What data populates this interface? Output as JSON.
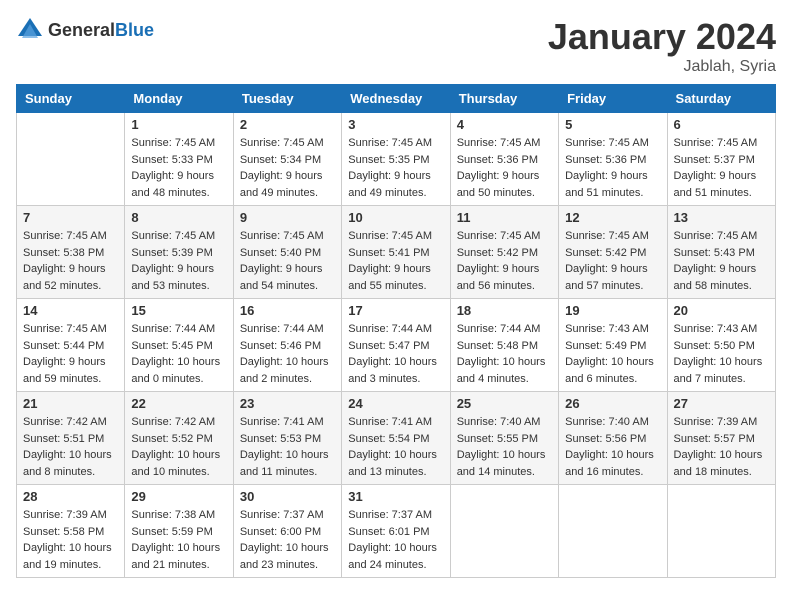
{
  "logo": {
    "general": "General",
    "blue": "Blue"
  },
  "title": "January 2024",
  "location": "Jablah, Syria",
  "days_of_week": [
    "Sunday",
    "Monday",
    "Tuesday",
    "Wednesday",
    "Thursday",
    "Friday",
    "Saturday"
  ],
  "weeks": [
    [
      {
        "day": "",
        "sunrise": "",
        "sunset": "",
        "daylight": ""
      },
      {
        "day": "1",
        "sunrise": "Sunrise: 7:45 AM",
        "sunset": "Sunset: 5:33 PM",
        "daylight": "Daylight: 9 hours and 48 minutes."
      },
      {
        "day": "2",
        "sunrise": "Sunrise: 7:45 AM",
        "sunset": "Sunset: 5:34 PM",
        "daylight": "Daylight: 9 hours and 49 minutes."
      },
      {
        "day": "3",
        "sunrise": "Sunrise: 7:45 AM",
        "sunset": "Sunset: 5:35 PM",
        "daylight": "Daylight: 9 hours and 49 minutes."
      },
      {
        "day": "4",
        "sunrise": "Sunrise: 7:45 AM",
        "sunset": "Sunset: 5:36 PM",
        "daylight": "Daylight: 9 hours and 50 minutes."
      },
      {
        "day": "5",
        "sunrise": "Sunrise: 7:45 AM",
        "sunset": "Sunset: 5:36 PM",
        "daylight": "Daylight: 9 hours and 51 minutes."
      },
      {
        "day": "6",
        "sunrise": "Sunrise: 7:45 AM",
        "sunset": "Sunset: 5:37 PM",
        "daylight": "Daylight: 9 hours and 51 minutes."
      }
    ],
    [
      {
        "day": "7",
        "sunrise": "Sunrise: 7:45 AM",
        "sunset": "Sunset: 5:38 PM",
        "daylight": "Daylight: 9 hours and 52 minutes."
      },
      {
        "day": "8",
        "sunrise": "Sunrise: 7:45 AM",
        "sunset": "Sunset: 5:39 PM",
        "daylight": "Daylight: 9 hours and 53 minutes."
      },
      {
        "day": "9",
        "sunrise": "Sunrise: 7:45 AM",
        "sunset": "Sunset: 5:40 PM",
        "daylight": "Daylight: 9 hours and 54 minutes."
      },
      {
        "day": "10",
        "sunrise": "Sunrise: 7:45 AM",
        "sunset": "Sunset: 5:41 PM",
        "daylight": "Daylight: 9 hours and 55 minutes."
      },
      {
        "day": "11",
        "sunrise": "Sunrise: 7:45 AM",
        "sunset": "Sunset: 5:42 PM",
        "daylight": "Daylight: 9 hours and 56 minutes."
      },
      {
        "day": "12",
        "sunrise": "Sunrise: 7:45 AM",
        "sunset": "Sunset: 5:42 PM",
        "daylight": "Daylight: 9 hours and 57 minutes."
      },
      {
        "day": "13",
        "sunrise": "Sunrise: 7:45 AM",
        "sunset": "Sunset: 5:43 PM",
        "daylight": "Daylight: 9 hours and 58 minutes."
      }
    ],
    [
      {
        "day": "14",
        "sunrise": "Sunrise: 7:45 AM",
        "sunset": "Sunset: 5:44 PM",
        "daylight": "Daylight: 9 hours and 59 minutes."
      },
      {
        "day": "15",
        "sunrise": "Sunrise: 7:44 AM",
        "sunset": "Sunset: 5:45 PM",
        "daylight": "Daylight: 10 hours and 0 minutes."
      },
      {
        "day": "16",
        "sunrise": "Sunrise: 7:44 AM",
        "sunset": "Sunset: 5:46 PM",
        "daylight": "Daylight: 10 hours and 2 minutes."
      },
      {
        "day": "17",
        "sunrise": "Sunrise: 7:44 AM",
        "sunset": "Sunset: 5:47 PM",
        "daylight": "Daylight: 10 hours and 3 minutes."
      },
      {
        "day": "18",
        "sunrise": "Sunrise: 7:44 AM",
        "sunset": "Sunset: 5:48 PM",
        "daylight": "Daylight: 10 hours and 4 minutes."
      },
      {
        "day": "19",
        "sunrise": "Sunrise: 7:43 AM",
        "sunset": "Sunset: 5:49 PM",
        "daylight": "Daylight: 10 hours and 6 minutes."
      },
      {
        "day": "20",
        "sunrise": "Sunrise: 7:43 AM",
        "sunset": "Sunset: 5:50 PM",
        "daylight": "Daylight: 10 hours and 7 minutes."
      }
    ],
    [
      {
        "day": "21",
        "sunrise": "Sunrise: 7:42 AM",
        "sunset": "Sunset: 5:51 PM",
        "daylight": "Daylight: 10 hours and 8 minutes."
      },
      {
        "day": "22",
        "sunrise": "Sunrise: 7:42 AM",
        "sunset": "Sunset: 5:52 PM",
        "daylight": "Daylight: 10 hours and 10 minutes."
      },
      {
        "day": "23",
        "sunrise": "Sunrise: 7:41 AM",
        "sunset": "Sunset: 5:53 PM",
        "daylight": "Daylight: 10 hours and 11 minutes."
      },
      {
        "day": "24",
        "sunrise": "Sunrise: 7:41 AM",
        "sunset": "Sunset: 5:54 PM",
        "daylight": "Daylight: 10 hours and 13 minutes."
      },
      {
        "day": "25",
        "sunrise": "Sunrise: 7:40 AM",
        "sunset": "Sunset: 5:55 PM",
        "daylight": "Daylight: 10 hours and 14 minutes."
      },
      {
        "day": "26",
        "sunrise": "Sunrise: 7:40 AM",
        "sunset": "Sunset: 5:56 PM",
        "daylight": "Daylight: 10 hours and 16 minutes."
      },
      {
        "day": "27",
        "sunrise": "Sunrise: 7:39 AM",
        "sunset": "Sunset: 5:57 PM",
        "daylight": "Daylight: 10 hours and 18 minutes."
      }
    ],
    [
      {
        "day": "28",
        "sunrise": "Sunrise: 7:39 AM",
        "sunset": "Sunset: 5:58 PM",
        "daylight": "Daylight: 10 hours and 19 minutes."
      },
      {
        "day": "29",
        "sunrise": "Sunrise: 7:38 AM",
        "sunset": "Sunset: 5:59 PM",
        "daylight": "Daylight: 10 hours and 21 minutes."
      },
      {
        "day": "30",
        "sunrise": "Sunrise: 7:37 AM",
        "sunset": "Sunset: 6:00 PM",
        "daylight": "Daylight: 10 hours and 23 minutes."
      },
      {
        "day": "31",
        "sunrise": "Sunrise: 7:37 AM",
        "sunset": "Sunset: 6:01 PM",
        "daylight": "Daylight: 10 hours and 24 minutes."
      },
      {
        "day": "",
        "sunrise": "",
        "sunset": "",
        "daylight": ""
      },
      {
        "day": "",
        "sunrise": "",
        "sunset": "",
        "daylight": ""
      },
      {
        "day": "",
        "sunrise": "",
        "sunset": "",
        "daylight": ""
      }
    ]
  ]
}
